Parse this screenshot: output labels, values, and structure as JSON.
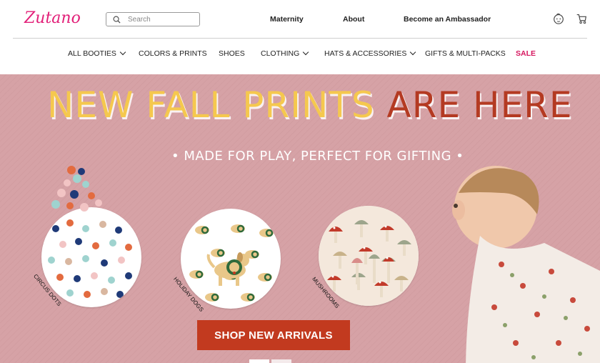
{
  "brand": {
    "logo_text": "Zutano"
  },
  "search": {
    "placeholder": "Search"
  },
  "toplinks": {
    "maternity": "Maternity",
    "about": "About",
    "ambassador": "Become an Ambassador"
  },
  "icons": {
    "account": "baby-face-icon",
    "cart": "stroller-cart-icon",
    "search": "search-icon"
  },
  "nav": {
    "items": [
      {
        "label": "ALL BOOTIES"
      },
      {
        "label": "COLORS & PRINTS"
      },
      {
        "label": "SHOES"
      },
      {
        "label": "CLOTHING"
      },
      {
        "label": "HATS & ACCESSORIES"
      },
      {
        "label": "GIFTS & MULTI-PACKS"
      },
      {
        "label": "SALE"
      }
    ]
  },
  "hero": {
    "headline_part1": "NEW FALL PRINTS",
    "headline_part2": "ARE HERE",
    "subline": "• MADE FOR PLAY, PERFECT FOR GIFTING •",
    "prints": [
      {
        "label": "CIRCUS DOTS"
      },
      {
        "label": "HOLIDAY DOGS"
      },
      {
        "label": "MUSHROOMS"
      }
    ],
    "cta": "SHOP NEW ARRIVALS"
  },
  "colors": {
    "brand_pink": "#e21f78",
    "hero_bg": "#d6a2a6",
    "cta_red": "#c23a1f",
    "headline_yellow": "#f5c84e",
    "headline_red": "#b43a22",
    "sale": "#d6175f"
  }
}
